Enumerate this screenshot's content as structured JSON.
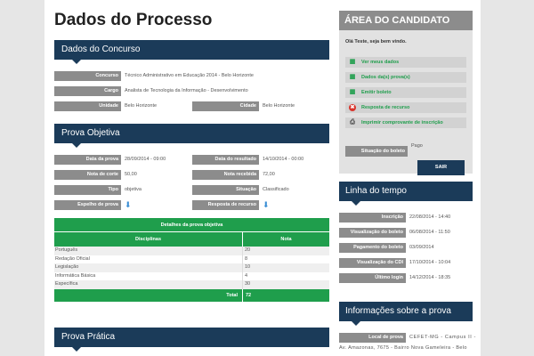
{
  "page": {
    "title": "Dados do Processo"
  },
  "concurso": {
    "title": "Dados do Concurso",
    "rows": [
      {
        "label": "Concurso",
        "value": "Técnico Administrativo em Educação 2014 - Belo Horizonte"
      },
      {
        "label": "Cargo",
        "value": "Analista de Tecnologia da Informação - Desenvolvimento"
      }
    ],
    "unidade": {
      "label": "Unidade",
      "value": "Belo Horizonte"
    },
    "cidade": {
      "label": "Cidade",
      "value": "Belo Horizonte"
    }
  },
  "prova_objetiva": {
    "title": "Prova Objetiva",
    "left": [
      {
        "label": "Data da prova",
        "value": "28/09/2014 - 09:00"
      },
      {
        "label": "Nota de corte",
        "value": "50,00"
      },
      {
        "label": "Tipo",
        "value": "objetiva"
      },
      {
        "label": "Espelho de prova",
        "value": ""
      }
    ],
    "right": [
      {
        "label": "Data do resultado",
        "value": "14/10/2014 - 00:00"
      },
      {
        "label": "Nota recebida",
        "value": "72,00"
      },
      {
        "label": "Situação",
        "value": "Classificado"
      },
      {
        "label": "Resposta de recurso",
        "value": ""
      }
    ],
    "download_icon": "download-arrow-icon"
  },
  "detalhes": {
    "title": "Detalhes da prova objetiva",
    "col_disciplinas": "Disciplinas",
    "col_nota": "Nota",
    "rows": [
      {
        "disciplina": "Português",
        "nota": "20"
      },
      {
        "disciplina": "Redação Oficial",
        "nota": "8"
      },
      {
        "disciplina": "Legislação",
        "nota": "10"
      },
      {
        "disciplina": "Informática Básica",
        "nota": "4"
      },
      {
        "disciplina": "Específica",
        "nota": "30"
      }
    ],
    "total_label": "Total",
    "total_value": "72"
  },
  "prova_pratica": {
    "title": "Prova Prática"
  },
  "candidato": {
    "title": "ÁREA DO CANDIDATO",
    "greeting": "Olá Teste, seja bem vindo.",
    "menu": [
      {
        "label": "Ver meus dados",
        "icon": "table-icon",
        "color": "#1f9e4c"
      },
      {
        "label": "Dados da(s) prova(s)",
        "icon": "table-icon",
        "color": "#1f9e4c"
      },
      {
        "label": "Emitir boleto",
        "icon": "table-icon",
        "color": "#1f9e4c"
      },
      {
        "label": "Resposta de recurso",
        "icon": "cancel-icon",
        "color": "#1f9e4c"
      },
      {
        "label": "Imprimir comprovante de inscrição",
        "icon": "printer-icon",
        "color": "#1f9e4c"
      }
    ],
    "situacao": {
      "label": "Situação do boleto",
      "value": "Pago"
    },
    "sair": "SAIR"
  },
  "linha_tempo": {
    "title": "Linha do tempo",
    "rows": [
      {
        "label": "Inscrição",
        "value": "22/08/2014 - 14:40"
      },
      {
        "label": "Visualização do boleto",
        "value": "06/08/2014 - 11:50"
      },
      {
        "label": "Pagamento do boleto",
        "value": "03/09/2014"
      },
      {
        "label": "Visualização do CDI",
        "value": "17/10/2014 - 10:04"
      },
      {
        "label": "Último login",
        "value": "14/12/2014 - 18:35"
      }
    ]
  },
  "informacoes": {
    "title": "Informações sobre a prova",
    "local_label": "Local de prova",
    "local_value": "CEFET-MG - Campus II -",
    "local_cont": "Av. Amazonas, 7675 - Bairro Nova Gameleira - Belo"
  },
  "colors": {
    "navy": "#1b3b59",
    "green": "#1f9e4c",
    "label_gray": "#8c8c8c"
  }
}
